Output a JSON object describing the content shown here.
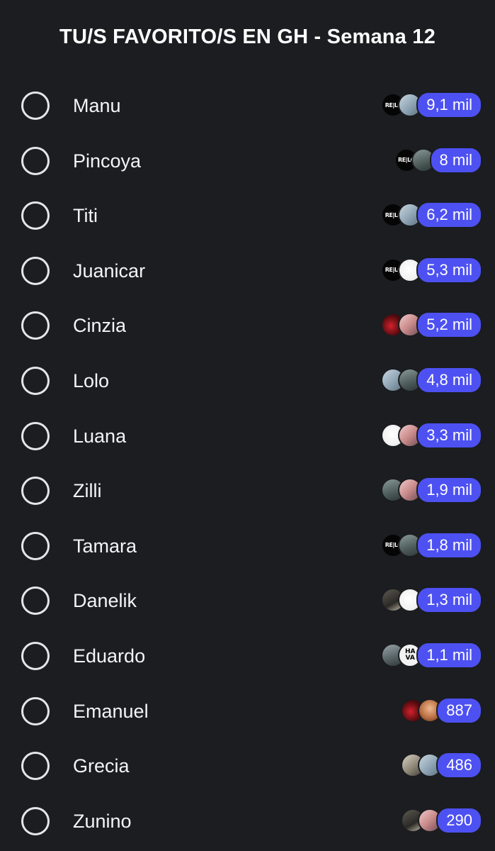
{
  "poll": {
    "title": "TU/S FAVORITO/S EN GH - Semana 12",
    "options": [
      {
        "label": "Manu",
        "count": "9,1 mil",
        "avatars": [
          "relc-avatar",
          "pale-avatar"
        ]
      },
      {
        "label": "Pincoya",
        "count": "8 mil",
        "avatars": [
          "relc-avatar",
          "grey-avatar"
        ]
      },
      {
        "label": "Titi",
        "count": "6,2 mil",
        "avatars": [
          "relc-avatar",
          "pale-avatar"
        ]
      },
      {
        "label": "Juanicar",
        "count": "5,3 mil",
        "avatars": [
          "relc-avatar",
          "white-avatar"
        ]
      },
      {
        "label": "Cinzia",
        "count": "5,2 mil",
        "avatars": [
          "red-avatar",
          "pink-avatar"
        ]
      },
      {
        "label": "Lolo",
        "count": "4,8 mil",
        "avatars": [
          "pale-avatar",
          "grey-avatar"
        ]
      },
      {
        "label": "Luana",
        "count": "3,3 mil",
        "avatars": [
          "white-avatar",
          "pink-avatar"
        ]
      },
      {
        "label": "Zilli",
        "count": "1,9 mil",
        "avatars": [
          "grey-avatar",
          "pink-avatar"
        ]
      },
      {
        "label": "Tamara",
        "count": "1,8 mil",
        "avatars": [
          "relc-avatar",
          "grey-avatar"
        ]
      },
      {
        "label": "Danelik",
        "count": "1,3 mil",
        "avatars": [
          "dark-avatar",
          "white-avatar"
        ]
      },
      {
        "label": "Eduardo",
        "count": "1,1 mil",
        "avatars": [
          "road-avatar",
          "hava-avatar"
        ]
      },
      {
        "label": "Emanuel",
        "count": "887",
        "avatars": [
          "red-avatar",
          "warm-avatar"
        ]
      },
      {
        "label": "Grecia",
        "count": "486",
        "avatars": [
          "lady-avatar",
          "pale-avatar"
        ]
      },
      {
        "label": "Zunino",
        "count": "290",
        "avatars": [
          "dark-avatar",
          "pink-avatar"
        ]
      }
    ],
    "avatar_text": {
      "relc": "RE|LC",
      "hava": "HA VA"
    }
  },
  "colors": {
    "background": "#1b1d21",
    "count_pill": "#4d51f2",
    "radio_border": "#e6e6e8",
    "text": "#f4f4f6"
  }
}
